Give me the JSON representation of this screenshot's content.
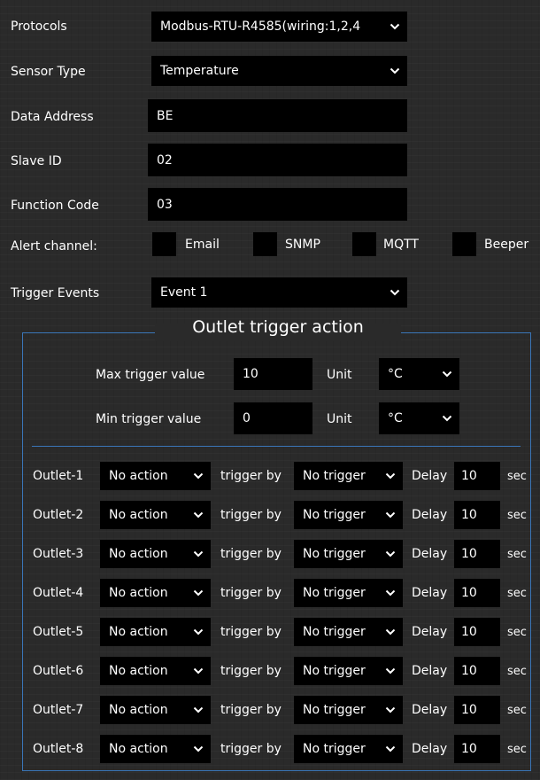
{
  "form": {
    "protocols": {
      "label": "Protocols",
      "value": "Modbus-RTU-R4585(wiring:1,2,4"
    },
    "sensor_type": {
      "label": "Sensor Type",
      "value": "Temperature"
    },
    "data_address": {
      "label": "Data Address",
      "value": "BE"
    },
    "slave_id": {
      "label": "Slave ID",
      "value": "02"
    },
    "function_code": {
      "label": "Function Code",
      "value": "03"
    },
    "alert_channel": {
      "label": "Alert channel:",
      "options": [
        {
          "label": "Email",
          "checked": false
        },
        {
          "label": "SNMP",
          "checked": false
        },
        {
          "label": "MQTT",
          "checked": false
        },
        {
          "label": "Beeper",
          "checked": false
        }
      ]
    },
    "trigger_events": {
      "label": "Trigger Events",
      "value": "Event 1"
    }
  },
  "outlet_trigger": {
    "legend": "Outlet trigger action",
    "max": {
      "label": "Max trigger value",
      "value": "10",
      "unit_label": "Unit",
      "unit": "°C"
    },
    "min": {
      "label": "Min trigger value",
      "value": "0",
      "unit_label": "Unit",
      "unit": "°C"
    },
    "trigger_by_label": "trigger by",
    "delay_label": "Delay",
    "sec_label": "sec",
    "outlets": [
      {
        "name": "Outlet-1",
        "action": "No action",
        "trigger": "No trigger",
        "delay": "10"
      },
      {
        "name": "Outlet-2",
        "action": "No action",
        "trigger": "No trigger",
        "delay": "10"
      },
      {
        "name": "Outlet-3",
        "action": "No action",
        "trigger": "No trigger",
        "delay": "10"
      },
      {
        "name": "Outlet-4",
        "action": "No action",
        "trigger": "No trigger",
        "delay": "10"
      },
      {
        "name": "Outlet-5",
        "action": "No action",
        "trigger": "No trigger",
        "delay": "10"
      },
      {
        "name": "Outlet-6",
        "action": "No action",
        "trigger": "No trigger",
        "delay": "10"
      },
      {
        "name": "Outlet-7",
        "action": "No action",
        "trigger": "No trigger",
        "delay": "10"
      },
      {
        "name": "Outlet-8",
        "action": "No action",
        "trigger": "No trigger",
        "delay": "10"
      }
    ]
  },
  "colors": {
    "background": "#2a2a2a",
    "field": "#000000",
    "text": "#ffffff",
    "accent_border": "#3a76b8"
  },
  "icons": {
    "dropdown": "chevron-down-icon"
  }
}
